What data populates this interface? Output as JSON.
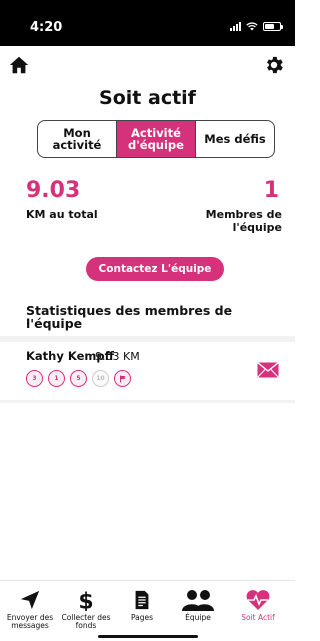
{
  "status_bar": {
    "time": "4:20"
  },
  "page": {
    "title": "Soit actif"
  },
  "tabs": [
    {
      "label": "Mon\nactivité"
    },
    {
      "label": "Activité\nd'équipe",
      "active": true
    },
    {
      "label": "Mes défis"
    }
  ],
  "stats": {
    "km_value": "9.03",
    "km_label": "KM au total",
    "members_value": "1",
    "members_label": "Membres de l'équipe"
  },
  "contact_button": {
    "label": "Contactez L'équipe"
  },
  "section": {
    "title": "Statistiques des membres de l'équipe"
  },
  "members": [
    {
      "name": "Kathy Kempff",
      "km": "9.03 KM",
      "badges": [
        {
          "text": "3",
          "earned": true
        },
        {
          "text": "1",
          "earned": true
        },
        {
          "text": "5",
          "earned": true
        },
        {
          "text": "10",
          "earned": false
        },
        {
          "text": "",
          "earned": true,
          "icon": "flag-icon"
        }
      ]
    }
  ],
  "bottom_nav": [
    {
      "label": "Envoyer des messages",
      "icon": "send-icon"
    },
    {
      "label": "Collecter des fonds",
      "icon": "dollar-icon"
    },
    {
      "label": "Pages",
      "icon": "document-icon"
    },
    {
      "label": "Équipe",
      "icon": "team-icon"
    },
    {
      "label": "Soit Actif",
      "icon": "heartbeat-icon",
      "active": true
    }
  ],
  "colors": {
    "accent": "#d6327b",
    "text": "#111111",
    "divider": "#f2f2f2"
  }
}
